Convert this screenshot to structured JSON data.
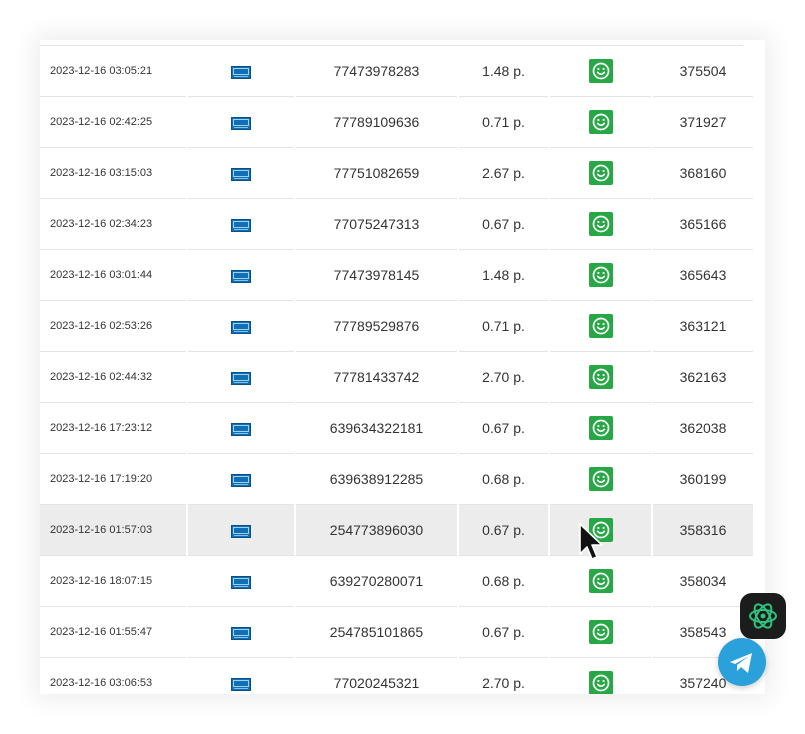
{
  "table": {
    "rows": [
      {
        "date": "2023-12-16 03:05:21",
        "number": "77473978283",
        "amount": "1.48 р.",
        "id": "375504"
      },
      {
        "date": "2023-12-16 02:42:25",
        "number": "77789109636",
        "amount": "0.71 р.",
        "id": "371927"
      },
      {
        "date": "2023-12-16 03:15:03",
        "number": "77751082659",
        "amount": "2.67 р.",
        "id": "368160"
      },
      {
        "date": "2023-12-16 02:34:23",
        "number": "77075247313",
        "amount": "0.67 р.",
        "id": "365166"
      },
      {
        "date": "2023-12-16 03:01:44",
        "number": "77473978145",
        "amount": "1.48 р.",
        "id": "365643"
      },
      {
        "date": "2023-12-16 02:53:26",
        "number": "77789529876",
        "amount": "0.71 р.",
        "id": "363121"
      },
      {
        "date": "2023-12-16 02:44:32",
        "number": "77781433742",
        "amount": "2.70 р.",
        "id": "362163"
      },
      {
        "date": "2023-12-16 17:23:12",
        "number": "639634322181",
        "amount": "0.67 р.",
        "id": "362038"
      },
      {
        "date": "2023-12-16 17:19:20",
        "number": "639638912285",
        "amount": "0.68 р.",
        "id": "360199"
      },
      {
        "date": "2023-12-16 01:57:03",
        "number": "254773896030",
        "amount": "0.67 р.",
        "id": "358316"
      },
      {
        "date": "2023-12-16 18:07:15",
        "number": "639270280071",
        "amount": "0.68 р.",
        "id": "358034"
      },
      {
        "date": "2023-12-16 01:55:47",
        "number": "254785101865",
        "amount": "0.67 р.",
        "id": "358543"
      },
      {
        "date": "2023-12-16 03:06:53",
        "number": "77020245321",
        "amount": "2.70 р.",
        "id": "357240"
      }
    ],
    "highlighted_row": 9,
    "operator_icon": "operator-logo-icon",
    "status_icon": "smiley-icon"
  },
  "colors": {
    "status_green": "#27a745",
    "operator_blue": "#1170b5",
    "telegram_blue": "#2aa1da",
    "row_highlight": "#ececec"
  },
  "floating_buttons": {
    "chat_icon": "chat-bot-icon",
    "telegram_icon": "telegram-icon"
  }
}
